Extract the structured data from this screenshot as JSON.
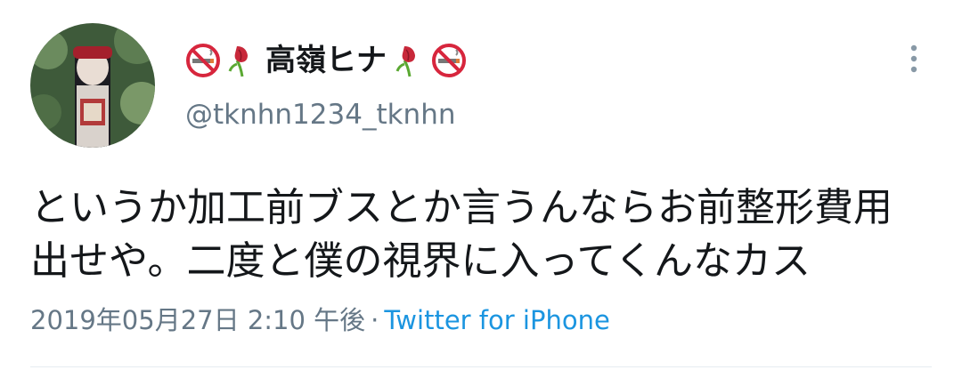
{
  "tweet": {
    "display_name": "高嶺ヒナ",
    "name_icons_left": [
      "no-smoking-icon",
      "wilted-tulip-icon"
    ],
    "name_icons_right": [
      "wilted-tulip-icon",
      "no-smoking-icon"
    ],
    "handle": "@tknhn1234_tknhn",
    "text": "というか加工前ブスとか言うんならお前整形費用\n出せや。二度と僕の視界に入ってくんなカス",
    "timestamp": "2019年05月27日 2:10 午後",
    "separator": "·",
    "source": "Twitter for iPhone"
  },
  "colors": {
    "text_primary": "#14171a",
    "text_secondary": "#657786",
    "link": "#1b95e0",
    "no_smoking_red": "#d7263d",
    "tulip_red": "#c8283a",
    "stem_green": "#5aa832"
  }
}
